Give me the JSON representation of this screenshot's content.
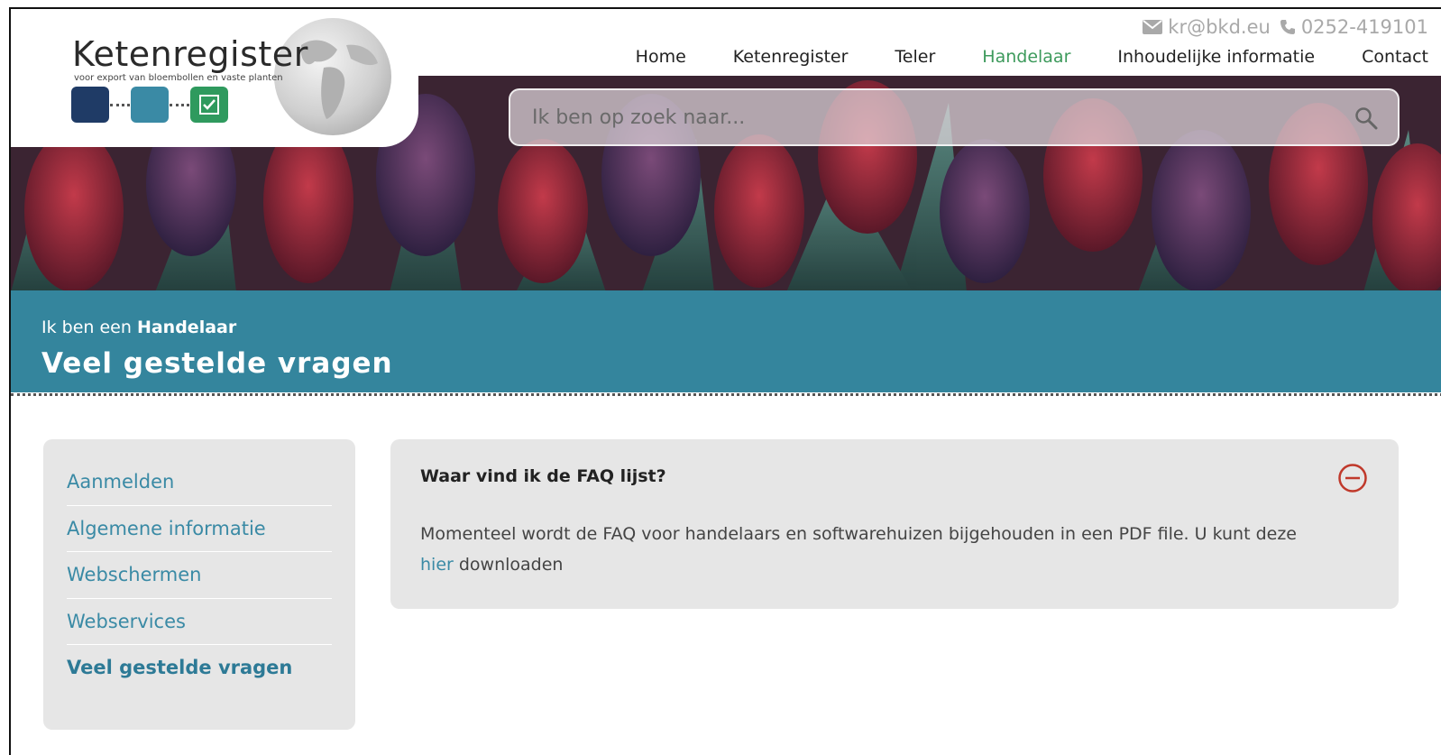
{
  "header": {
    "logo": {
      "title": "Ketenregister",
      "tagline": "voor export van bloembollen en vaste planten"
    },
    "contact": {
      "email": "kr@bkd.eu",
      "phone": "0252-419101"
    },
    "nav": [
      {
        "label": "Home"
      },
      {
        "label": "Ketenregister"
      },
      {
        "label": "Teler"
      },
      {
        "label": "Handelaar",
        "active": true
      },
      {
        "label": "Inhoudelijke informatie"
      },
      {
        "label": "Contact"
      }
    ],
    "search": {
      "placeholder": "Ik ben op zoek naar..."
    }
  },
  "banner": {
    "prefix": "Ik ben een",
    "role": "Handelaar",
    "title": "Veel gestelde vragen"
  },
  "sidebar": {
    "items": [
      {
        "label": "Aanmelden"
      },
      {
        "label": "Algemene informatie"
      },
      {
        "label": "Webschermen"
      },
      {
        "label": "Webservices"
      },
      {
        "label": "Veel gestelde vragen",
        "active": true
      }
    ]
  },
  "faq": {
    "question": "Waar vind ik de FAQ lijst?",
    "answer_before": "Momenteel wordt de FAQ voor handelaars en softwarehuizen bijgehouden in een PDF file. U kunt deze ",
    "answer_link": "hier",
    "answer_after": " downloaden"
  },
  "colors": {
    "band": "#34859d",
    "nav_active": "#3d9a5c",
    "link": "#3a8aa5",
    "toggle": "#c0392b"
  }
}
